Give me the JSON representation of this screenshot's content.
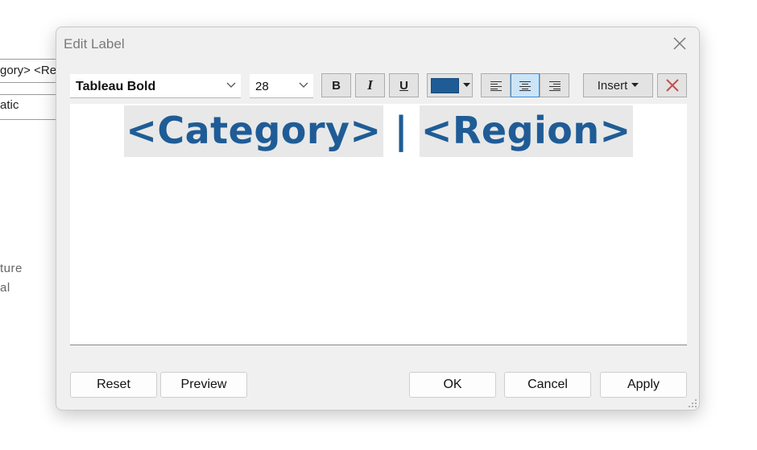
{
  "background": {
    "row1_text": "gory> <Re",
    "row2_text": "atic",
    "text1": "ture",
    "text2": "al"
  },
  "dialog": {
    "title": "Edit Label",
    "toolbar": {
      "font": "Tableau Bold",
      "size": "28",
      "bold": "B",
      "italic": "I",
      "underline": "U",
      "text_color": "#1f5c96",
      "insert": "Insert",
      "alignment_selected": "center"
    },
    "editor": {
      "field1": "<Category>",
      "separator": "|",
      "field2": "<Region>"
    },
    "buttons": {
      "reset": "Reset",
      "preview": "Preview",
      "ok": "OK",
      "cancel": "Cancel",
      "apply": "Apply"
    }
  }
}
